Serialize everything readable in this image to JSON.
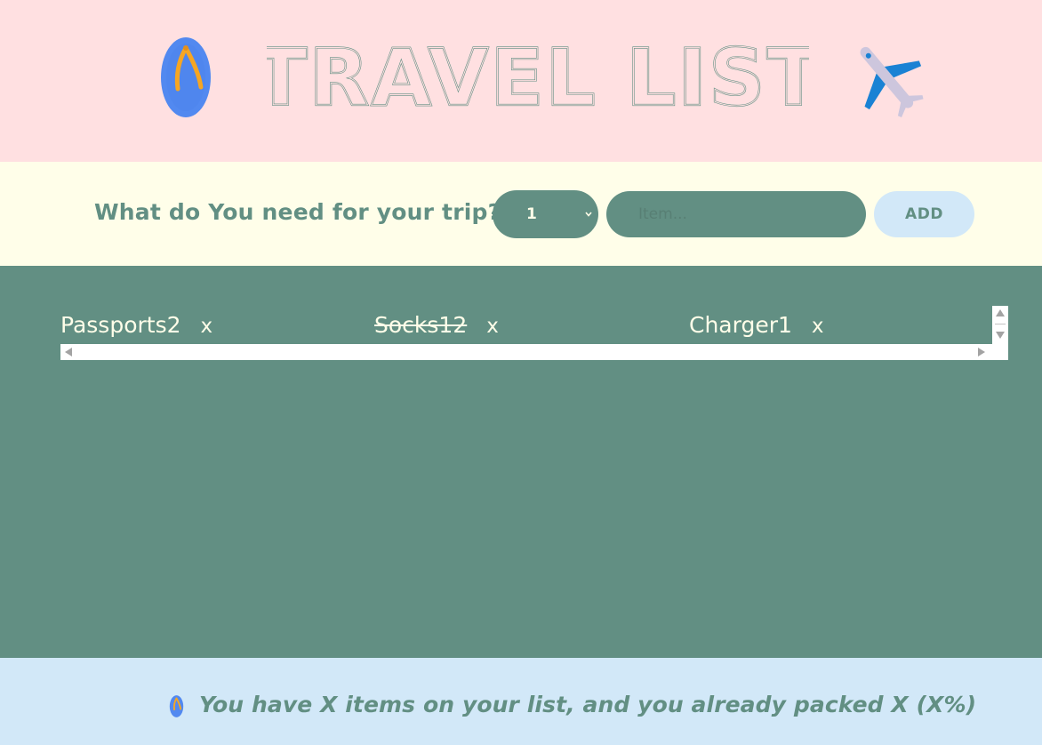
{
  "header": {
    "title": "TRAVEL LIST",
    "left_icon": "flip-flop-icon",
    "right_icon": "airplane-icon"
  },
  "form": {
    "question": "What do You need for your trip?",
    "quantity_selected": "1",
    "item_placeholder": "Item...",
    "add_label": "ADD"
  },
  "list": {
    "items": [
      {
        "label": "Passports2",
        "packed": false,
        "remove_label": "x"
      },
      {
        "label": "Socks12",
        "packed": true,
        "remove_label": "x"
      },
      {
        "label": "Charger1",
        "packed": false,
        "remove_label": "x"
      }
    ]
  },
  "footer": {
    "icon": "flip-flop-icon",
    "stats": "You have X items on your list, and you already packed X (X%)"
  },
  "colors": {
    "header_bg": "#ffe0e1",
    "form_bg": "#fffee9",
    "list_bg": "#628f83",
    "footer_bg": "#d2e8f8",
    "accent": "#628f83",
    "light_text": "#fffee9"
  }
}
